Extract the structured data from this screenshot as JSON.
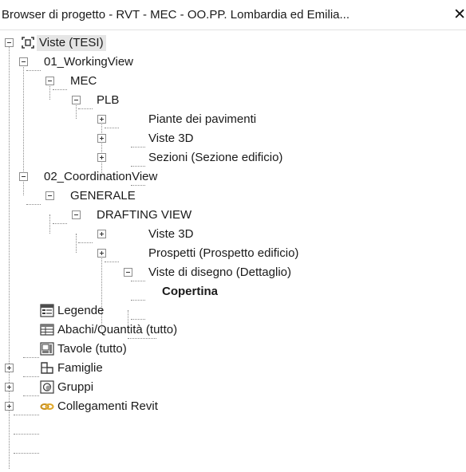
{
  "window": {
    "title": "Browser di progetto - RVT - MEC - OO.PP. Lombardia ed Emilia...",
    "close_glyph": "✕"
  },
  "tree": {
    "root": {
      "label": "Viste (TESI)",
      "icon": "views-icon"
    },
    "working_view": {
      "label": "01_WorkingView"
    },
    "mec": {
      "label": "MEC"
    },
    "plb": {
      "label": "PLB"
    },
    "floor_plans": {
      "label": "Piante dei pavimenti"
    },
    "views_3d_a": {
      "label": "Viste 3D"
    },
    "sections": {
      "label": "Sezioni (Sezione edificio)"
    },
    "coordination_view": {
      "label": "02_CoordinationView"
    },
    "generale": {
      "label": "GENERALE"
    },
    "drafting_view": {
      "label": "DRAFTING VIEW"
    },
    "views_3d_b": {
      "label": "Viste 3D"
    },
    "elevations": {
      "label": "Prospetti (Prospetto edificio)"
    },
    "drafting_views": {
      "label": "Viste di disegno (Dettaglio)"
    },
    "copertina": {
      "label": "Copertina"
    },
    "legends": {
      "label": "Legende",
      "icon": "legend-icon"
    },
    "schedules": {
      "label": "Abachi/Quantità (tutto)",
      "icon": "schedule-icon"
    },
    "sheets": {
      "label": "Tavole (tutto)",
      "icon": "sheet-icon"
    },
    "families": {
      "label": "Famiglie",
      "icon": "family-icon"
    },
    "groups": {
      "label": "Gruppi",
      "icon": "group-icon"
    },
    "revit_links": {
      "label": "Collegamenti Revit",
      "icon": "revit-link-icon"
    }
  }
}
